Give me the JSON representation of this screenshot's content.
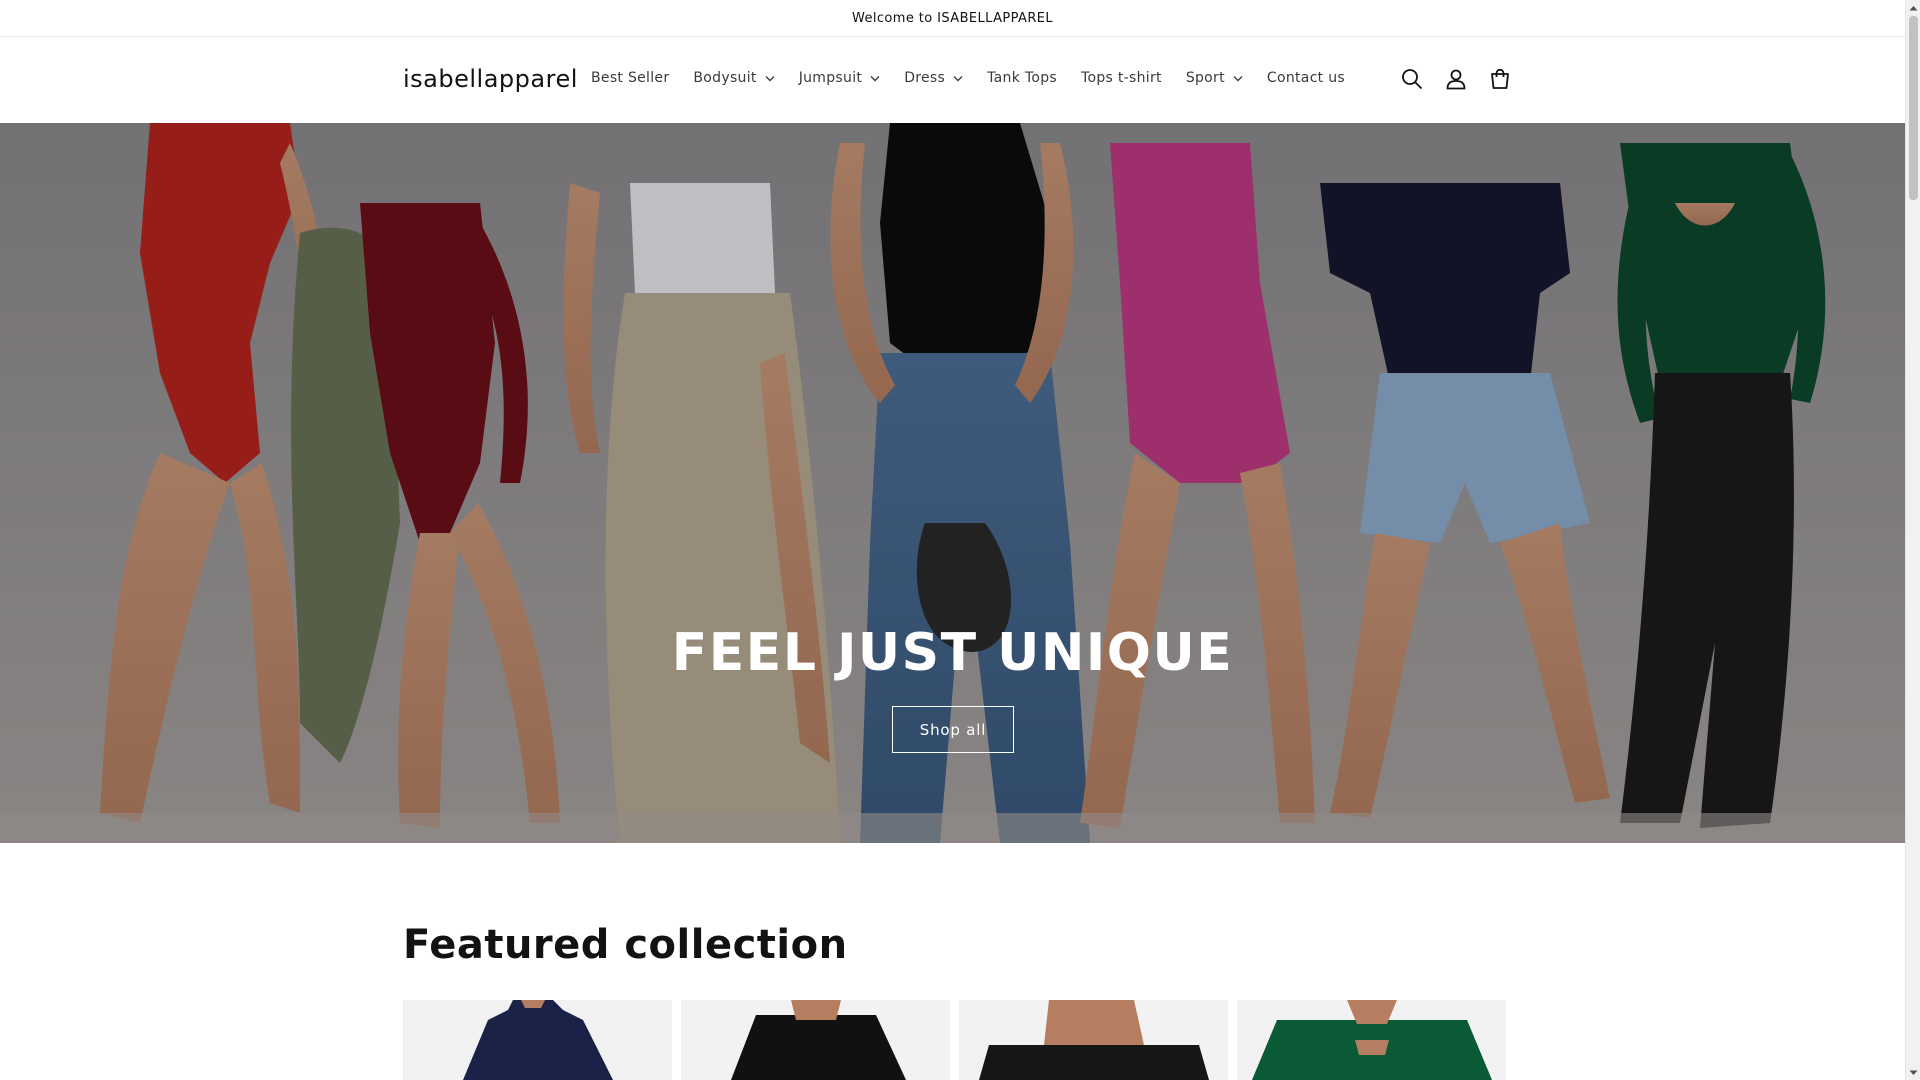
{
  "announcement": {
    "text": "Welcome to ISABELLAPPAREL"
  },
  "header": {
    "logo": "isabellapparel",
    "nav": [
      {
        "label": "Best Seller",
        "has_dropdown": false
      },
      {
        "label": "Bodysuit",
        "has_dropdown": true
      },
      {
        "label": "Jumpsuit",
        "has_dropdown": true
      },
      {
        "label": "Dress",
        "has_dropdown": true
      },
      {
        "label": "Tank Tops",
        "has_dropdown": false
      },
      {
        "label": "Tops t-shirt",
        "has_dropdown": false
      },
      {
        "label": "Sport",
        "has_dropdown": true
      },
      {
        "label": "Contact us",
        "has_dropdown": false
      }
    ],
    "icons": [
      "search-icon",
      "account-icon",
      "cart-icon"
    ]
  },
  "hero": {
    "title": "FEEL JUST UNIQUE",
    "button_label": "Shop all",
    "model_colors": [
      "#b8241e",
      "#6e0f1a",
      "#e9e9ee",
      "#0d0d0d",
      "#c03a86",
      "#161830",
      "#0d4a2e"
    ]
  },
  "featured": {
    "title": "Featured collection",
    "product_colors": [
      "#1a2247",
      "#111111",
      "#161616",
      "#0b5a36"
    ]
  },
  "colors": {
    "text": "#121212",
    "nav_text": "#3a3a3a",
    "border": "#e6e6e6",
    "hero_overlay_text": "#ffffff"
  }
}
